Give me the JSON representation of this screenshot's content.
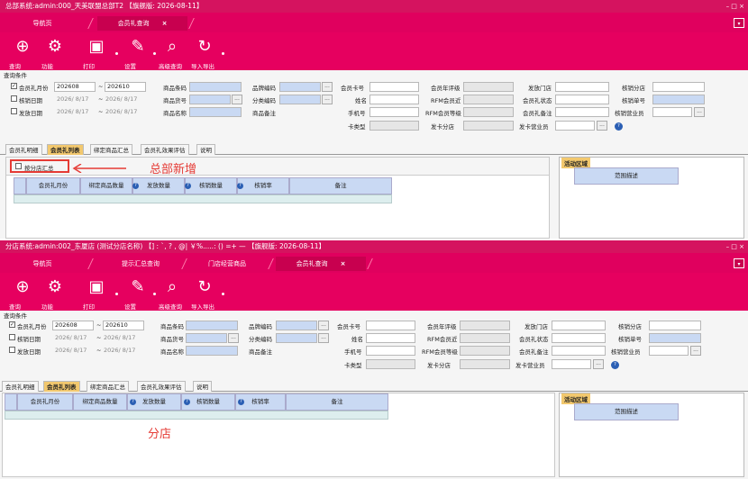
{
  "top": {
    "title": "总部系统:admin:000_天美联盟总部T2     【旗舰版: 2026-08-11】",
    "window_controls": "– □ ×",
    "tabs": [
      "导航页",
      "会员礼查询"
    ],
    "toolbar": [
      "查询",
      "功能",
      "打印",
      "设置",
      "高级查询",
      "导入导出"
    ],
    "note": "总部新增",
    "checkbox_label": "按分店汇总"
  },
  "bottom": {
    "title": "分店系统:admin:002_东厦店 (测试分店名称) 【] :  `,  ? ,  @| ￥%.....: () =+ —      【旗舰版: 2026-08-11】",
    "window_controls": "– □ ×",
    "tabs": [
      "导航页",
      "提示汇总查询",
      "门店经营商品",
      "会员礼查询"
    ],
    "toolbar": [
      "查询",
      "功能",
      "打印",
      "设置",
      "高级查询",
      "导入导出"
    ],
    "note": "分店"
  },
  "common": {
    "query_section": "查询条件",
    "close_mark": "×",
    "row1": {
      "month_label": "会员礼月份",
      "from": "202608",
      "to": "202610",
      "goods_code": "商品条码",
      "brand_code": "品牌编码",
      "card_no": "会员卡号",
      "year_rating": "会员年评级",
      "issue_store": "发放门店",
      "verify_store": "核销分店"
    },
    "row2": {
      "verify_date": "核销日期",
      "date_from": "2026/ 8/17",
      "date_to": "2026/ 8/17",
      "goods_no": "商品货号",
      "category_code": "分类编码",
      "name": "姓名",
      "rfm_recent": "RFM会员近",
      "gift_status": "会员礼状态",
      "verify_no": "核销单号"
    },
    "row3": {
      "issue_date": "发放日期",
      "goods_name": "商品名称",
      "goods_note": "商品备注",
      "mobile": "手机号",
      "rfm_level": "RFM会员等级",
      "gift_note": "会员礼备注",
      "verify_clerk": "核销营业员"
    },
    "row4": {
      "card_type": "卡类型",
      "issue_branch": "发卡分店",
      "issue_clerk": "发卡营业员"
    },
    "dash": "~",
    "ellipsis": "...",
    "subtabs": [
      "会员礼明细",
      "会员礼列表",
      "绑定商品汇总",
      "会员礼效果评估",
      "说明"
    ],
    "grid_headers": [
      "会员礼月份",
      "绑定商品数量",
      "发放数量",
      "核销数量",
      "核销率",
      "备注"
    ],
    "side_tab": "活动区域",
    "side_header": "范围描述"
  }
}
